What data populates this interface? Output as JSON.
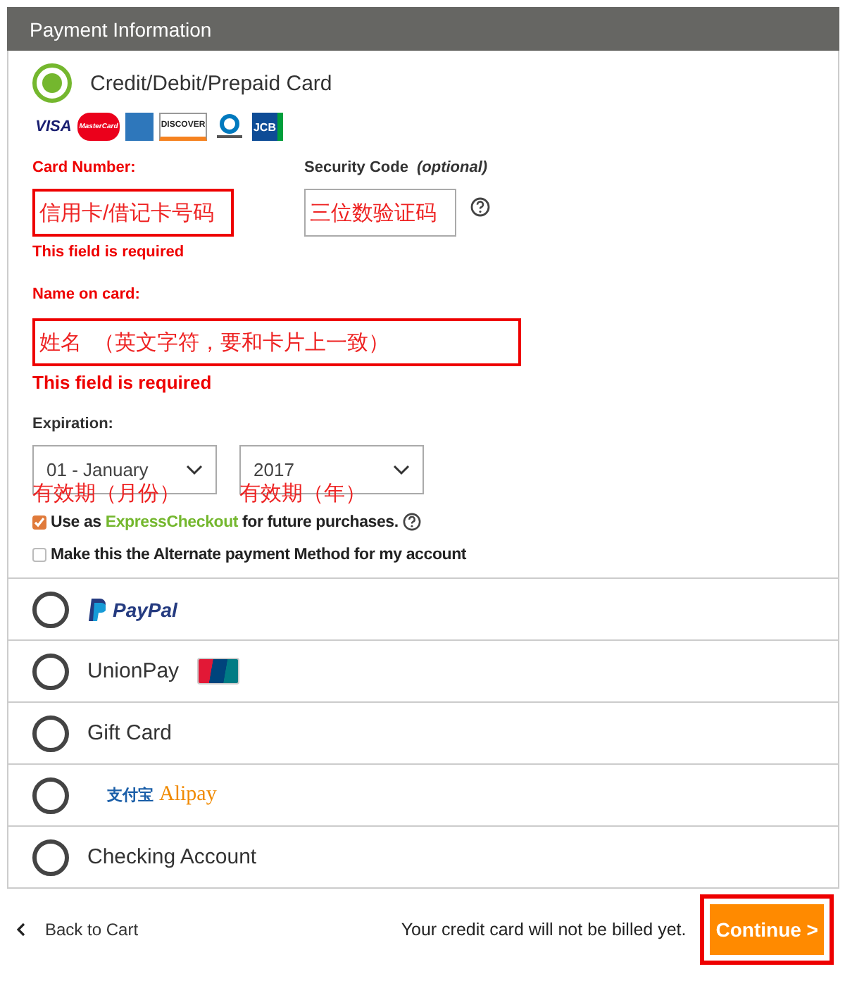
{
  "header": {
    "title": "Payment Information"
  },
  "methods": [
    {
      "kind": "card",
      "label": "Credit/Debit/Prepaid Card",
      "selected": true
    },
    {
      "kind": "paypal",
      "label": "PayPal",
      "selected": false
    },
    {
      "kind": "unionpay",
      "label": "UnionPay",
      "selected": false
    },
    {
      "kind": "text",
      "label": "Gift Card",
      "selected": false
    },
    {
      "kind": "alipay",
      "label": "支付宝",
      "label_2": "Alipay",
      "selected": false
    },
    {
      "kind": "text",
      "label": "Checking Account",
      "selected": false
    }
  ],
  "card_brands": [
    {
      "kind": "visa",
      "label": "VISA"
    },
    {
      "kind": "mastercard",
      "label": "MasterCard"
    },
    {
      "kind": "amex"
    },
    {
      "kind": "discover",
      "label": "DISCOVER"
    },
    {
      "kind": "diners"
    },
    {
      "kind": "jcb",
      "label": "JCB"
    }
  ],
  "card_form": {
    "card_number": {
      "label": "Card Number:",
      "value": "信用卡/借记卡号码",
      "invalid": true,
      "error": "This field is required"
    },
    "security_code": {
      "label": "Security Code",
      "note": "(optional)",
      "value": "三位数验证码",
      "invalid": false
    },
    "name": {
      "label": "Name on card:",
      "value": "姓名  （英文字符，要和卡片上一致）",
      "invalid": true,
      "error": "This field is required"
    },
    "expiration": {
      "label": "Expiration:",
      "month": "01 - January",
      "year": "2017",
      "month_note": "有效期（月份）",
      "year_note": "有效期（年）"
    },
    "checkboxes": [
      {
        "checked": true,
        "before": "Use as ",
        "brand": "ExpressCheckout",
        "after": " for future purchases.",
        "help": true
      },
      {
        "checked": false,
        "before": "Make this the Alternate payment Method for my account",
        "help": false
      }
    ]
  },
  "footer": {
    "back": "Back to Cart",
    "note": "Your credit card will not be billed yet.",
    "continue": "Continue >",
    "continue_highlighted": true
  }
}
